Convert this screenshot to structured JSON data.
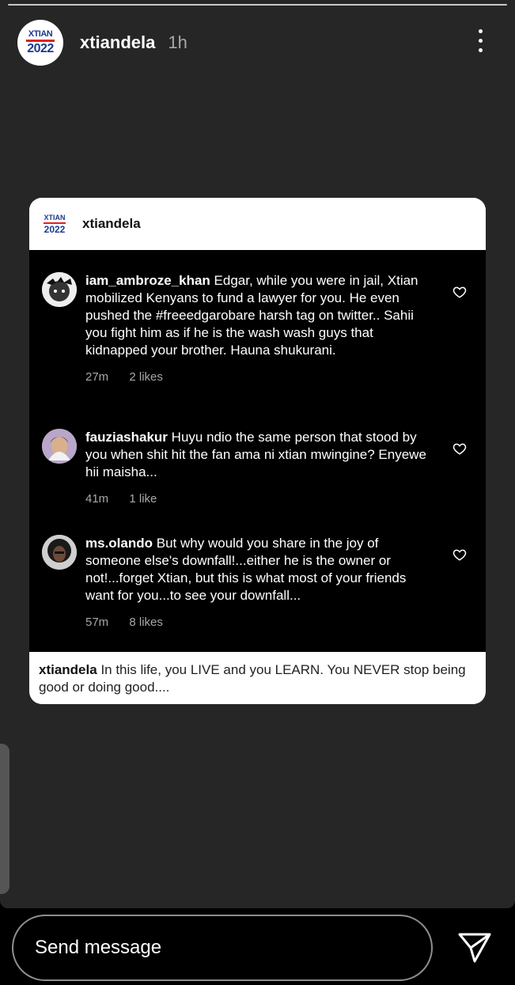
{
  "story": {
    "username": "xtiandela",
    "time": "1h",
    "logo": {
      "top": "XTIAN",
      "year": "2022"
    }
  },
  "card": {
    "username": "xtiandela",
    "comments": [
      {
        "user": "iam_ambroze_khan",
        "text": "Edgar, while you were in jail, Xtian mobilized Kenyans to fund a lawyer for you. He even pushed the #freeedgarobare harsh tag on twitter.. Sahii you fight him as if he is the wash wash guys that kidnapped your brother. Hauna shukurani.",
        "time": "27m",
        "likes": "2 likes"
      },
      {
        "user": "fauziashakur",
        "text": "Huyu ndio the same person that stood by you when shit hit the fan ama ni xtian mwingine? Enyewe hii maisha...",
        "time": "41m",
        "likes": "1 like"
      },
      {
        "user": "ms.olando",
        "text": "But why would you share in the joy of someone else's downfall!...either he is the owner or not!...forget Xtian, but this is what most of your friends want for you...to see your downfall...",
        "time": "57m",
        "likes": "8 likes"
      }
    ],
    "caption": {
      "user": "xtiandela",
      "text": "In this life, you LIVE and you LEARN. You NEVER stop being good or doing good...."
    }
  },
  "footer": {
    "placeholder": "Send message"
  }
}
